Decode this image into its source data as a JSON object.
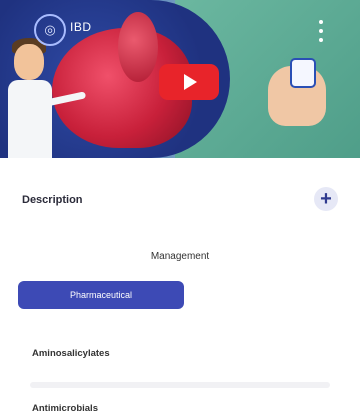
{
  "video": {
    "title": "IBD",
    "logo_icon": "globe-icon",
    "play_icon": "play-icon",
    "menu_icon": "more-vertical-icon",
    "play_color": "#e8242a"
  },
  "description": {
    "label": "Description",
    "expand_icon": "plus-icon",
    "expand_symbol": "+"
  },
  "management": {
    "title": "Management",
    "tabs": [
      {
        "label": "Pharmaceutical",
        "active": true
      },
      {
        "label": "",
        "active": false
      }
    ],
    "items": [
      {
        "label": "Aminosalicylates"
      },
      {
        "label": "Antimicrobials"
      }
    ]
  },
  "colors": {
    "accent": "#3d4ab5"
  }
}
